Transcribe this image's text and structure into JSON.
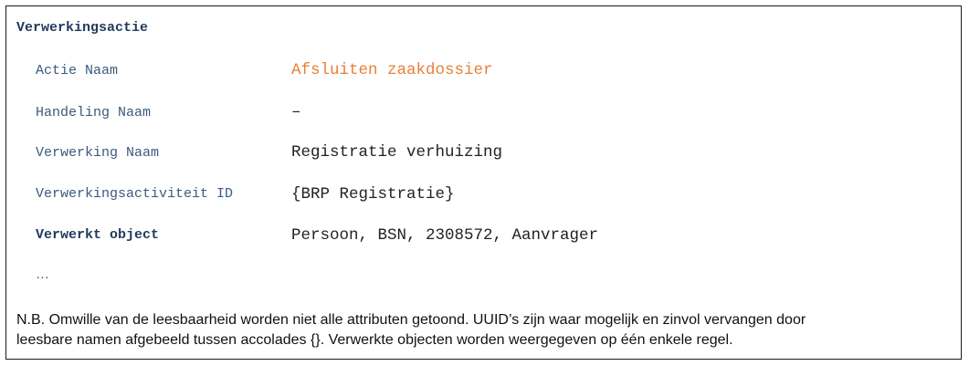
{
  "heading": "Verwerkingsactie",
  "rows": [
    {
      "label": "Actie Naam",
      "value": "Afsluiten zaakdossier"
    },
    {
      "label": "Handeling Naam",
      "value": "–"
    },
    {
      "label": "Verwerking Naam",
      "value": "Registratie verhuizing"
    },
    {
      "label": "Verwerkingsactiviteit ID",
      "value": "{BRP Registratie}"
    },
    {
      "label": "Verwerkt object",
      "value": "Persoon, BSN, 2308572, Aanvrager"
    }
  ],
  "ellipsis": "…",
  "note_lines": [
    "N.B. Omwille van de leesbaarheid worden niet alle attributen getoond. UUID’s zijn waar mogelijk en zinvol vervangen door",
    "leesbare namen afgebeeld tussen accolades {}. Verwerkte objecten worden weergegeven op één enkele regel."
  ],
  "colors": {
    "accent": "#e8803a",
    "label": "#3b5a7c",
    "heading": "#1f3b5c"
  }
}
